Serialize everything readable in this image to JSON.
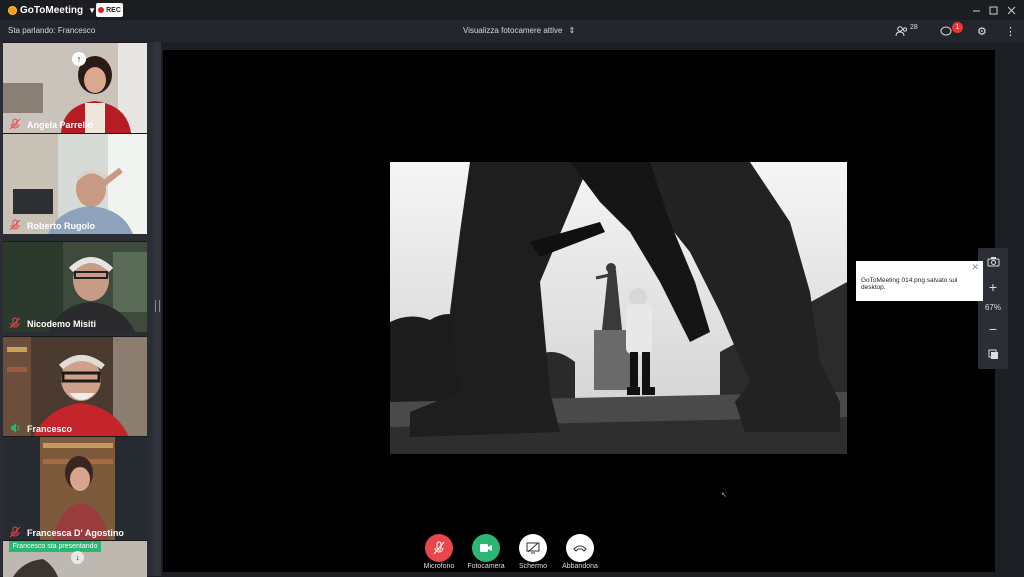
{
  "app": {
    "name": "GoToMeeting",
    "rec_label": "REC"
  },
  "toolbar": {
    "speaking": "Sta parlando: Francesco",
    "camera_view": "Visualizza fotocamere attive",
    "attendees_count": "28",
    "chat_badge": "1"
  },
  "participants": [
    {
      "name": "Angela Parrello",
      "muted": true
    },
    {
      "name": "Roberto Rugolo",
      "muted": true
    },
    {
      "name": "Nicodemo Misiti",
      "muted": true
    },
    {
      "name": "Francesco",
      "muted": false
    },
    {
      "name": "Francesca D' Agostino",
      "muted": true
    }
  ],
  "presenting_label": "Francesco sta presentando",
  "zoom": {
    "level": "67%"
  },
  "toast": {
    "message": "GoToMeeting 014.png salvato sul desktop."
  },
  "controls": [
    {
      "label": "Microfono",
      "color": "#e8474c"
    },
    {
      "label": "Fotocamera",
      "color": "#2bb673"
    },
    {
      "label": "Schermo",
      "color": "#ffffff"
    },
    {
      "label": "Abbandona",
      "color": "#ffffff"
    }
  ],
  "colors": {
    "accent": "#f29b1d",
    "presenting": "#2bb673",
    "muted": "#e8474c"
  }
}
